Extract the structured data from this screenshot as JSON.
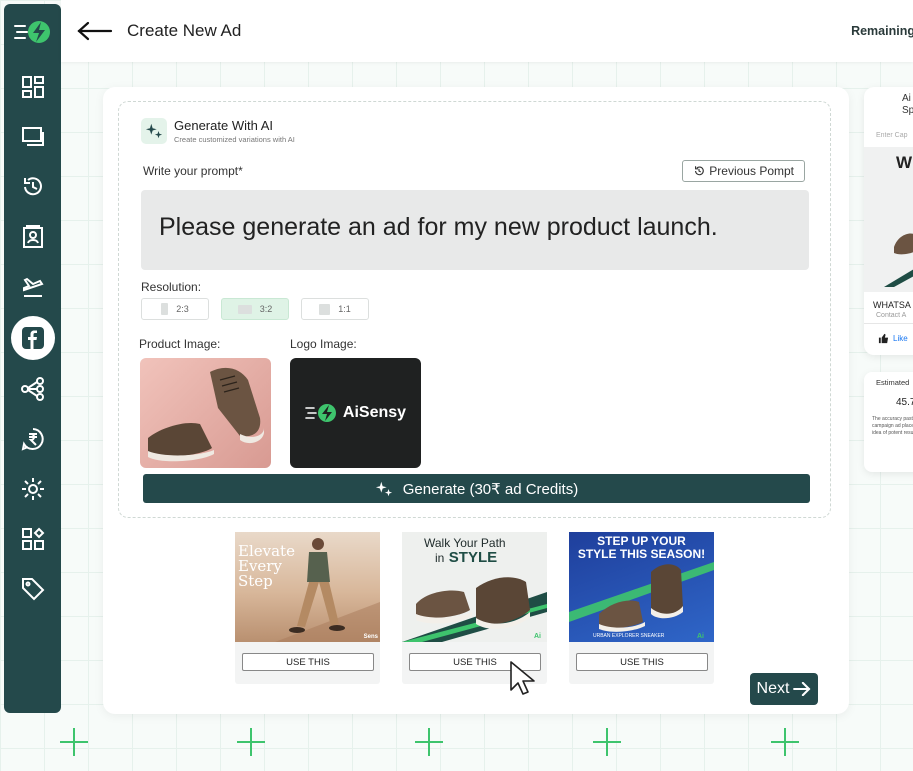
{
  "header": {
    "title": "Create New Ad",
    "remaining": "Remaining A"
  },
  "ai_panel": {
    "title": "Generate With AI",
    "subtitle": "Create customized variations with AI",
    "prompt_label": "Write your prompt*",
    "previous_prompt_label": "Previous Pompt",
    "prompt_value": "Please generate an ad for my new product launch.",
    "resolution_label": "Resolution:",
    "resolutions": [
      {
        "label": "2:3",
        "selected": false
      },
      {
        "label": "3:2",
        "selected": true
      },
      {
        "label": "1:1",
        "selected": false
      }
    ],
    "product_image_label": "Product Image:",
    "logo_image_label": "Logo Image:",
    "logo_brand_text": "AiSensy",
    "generate_label": "Generate (30₹ ad Credits)"
  },
  "variations": [
    {
      "headline": "Elevate Every Step",
      "brand": "Sens",
      "button": "USE THIS"
    },
    {
      "headline_1": "Walk Your Path",
      "headline_2": "in",
      "headline_3": "STYLE",
      "brand": "Ai",
      "button": "USE THIS"
    },
    {
      "headline_1": "STEP UP YOUR",
      "headline_2": "STYLE THIS SEASON!",
      "tagline": "URBAN EXPLORER SNEAKER",
      "brand": "Ai",
      "button": "USE THIS"
    }
  ],
  "next_label": "Next",
  "preview": {
    "title_1": "Ai",
    "title_2": "Sp",
    "caption_placeholder": "Enter Cap",
    "ad_letter": "W",
    "business_name": "WHATSA",
    "contact": "Contact A",
    "like": "Like"
  },
  "estimate": {
    "title": "Estimated",
    "value": "45.7",
    "note": "The accuracy past campaign ad placement idea of potent results."
  },
  "colors": {
    "sidebar": "#24494b",
    "accent_green": "#3ec46d",
    "button_dark": "#24494b"
  }
}
